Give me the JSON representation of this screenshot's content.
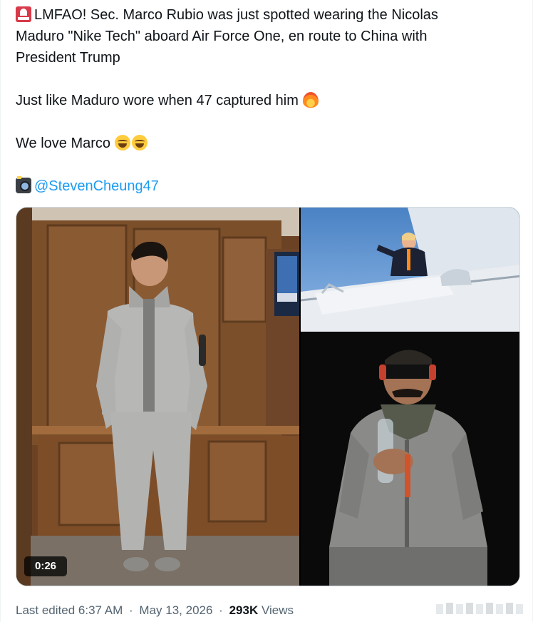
{
  "tweet": {
    "line1": "LMFAO! Sec. Marco Rubio was just spotted wearing the Nicolas",
    "line2": "Maduro \"Nike Tech\" aboard Air Force One, en route to China with",
    "line3": "President Trump",
    "line4": "Just like Maduro wore when 47 captured him",
    "line5": "We love Marco",
    "mention": "@StevenCheung47",
    "icons": {
      "siren": "police-car-light-emoji",
      "fire": "fire-emoji",
      "laugh": "face-with-tears-of-joy-emoji",
      "camera": "camera-with-flash-emoji"
    }
  },
  "media": {
    "video_duration": "0:26"
  },
  "meta": {
    "edited_label": "Last edited 6:37 AM",
    "date": "May 13, 2026",
    "separator": "·",
    "views_count": "293K",
    "views_label": "Views"
  },
  "colors": {
    "text": "#0f1419",
    "secondary": "#536471",
    "link": "#1d9bf0",
    "border": "#cfd9de"
  }
}
